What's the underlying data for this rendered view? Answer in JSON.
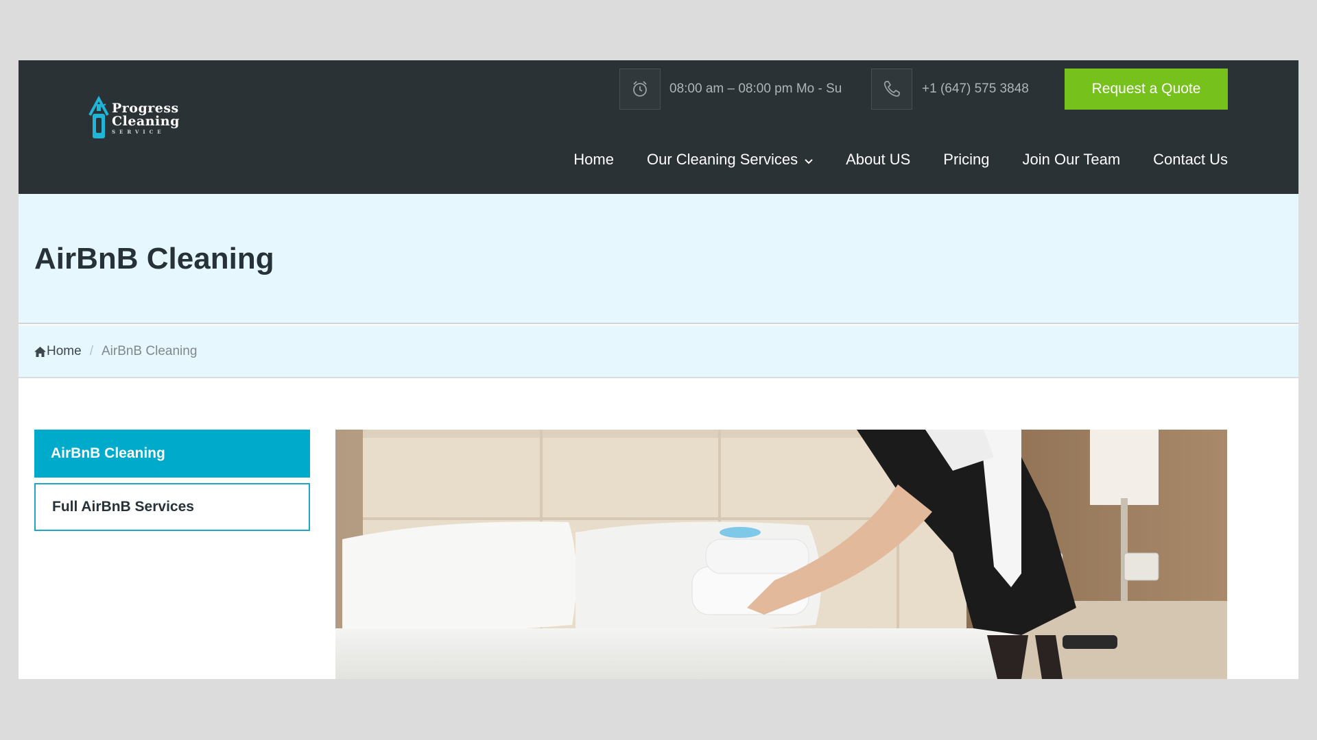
{
  "brand": {
    "logo_line1": "Progress",
    "logo_line2": "Cleaning",
    "logo_line3": "SERVICE",
    "logo_icon": "house-bottle-logo",
    "accent_color": "#1fb5d6"
  },
  "header": {
    "hours_icon": "alarm-clock-icon",
    "hours": "08:00 am – 08:00 pm Mo - Su",
    "phone_icon": "phone-icon",
    "phone": "+1 (647) 575 3848",
    "quote_button": "Request a Quote",
    "quote_color": "#76c11b"
  },
  "nav": {
    "items": [
      {
        "label": "Home"
      },
      {
        "label": "Our Cleaning Services",
        "has_dropdown": true
      },
      {
        "label": "About US"
      },
      {
        "label": "Pricing"
      },
      {
        "label": "Join Our Team"
      },
      {
        "label": "Contact Us"
      }
    ]
  },
  "page": {
    "title": "AirBnB Cleaning"
  },
  "breadcrumb": {
    "home_icon": "home-icon",
    "home": "Home",
    "separator": "/",
    "current": "AirBnB Cleaning"
  },
  "sidebar": {
    "items": [
      {
        "label": "AirBnB Cleaning",
        "active": true,
        "color": "#00aacb"
      },
      {
        "label": "Full AirBnB Services",
        "active": false
      }
    ]
  },
  "hero": {
    "image": "housekeeper-making-bed-photo"
  }
}
